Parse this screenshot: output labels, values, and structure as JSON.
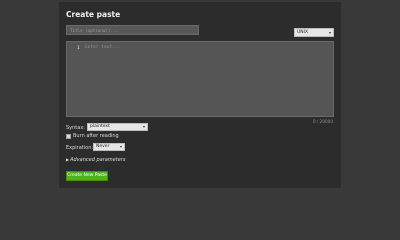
{
  "form": {
    "title": "Create paste",
    "title_placeholder": "Title (optional)...",
    "format_value": "UNIX",
    "editor": {
      "line_number": "1",
      "placeholder": "Enter text...",
      "value": ""
    },
    "char_count": "0 / 20000",
    "syntax": {
      "label": "Syntax:",
      "value": "plaintext"
    },
    "burn_after_reading": {
      "label": "Burn after reading",
      "checked": false
    },
    "expiration": {
      "label": "Expiration:",
      "value": "Never"
    },
    "advanced_label": "Advanced parameters",
    "advanced_icon": "triangle-right-icon",
    "submit_label": "Create New Paste"
  },
  "colors": {
    "page_bg": "#393939",
    "panel_bg": "#2c2c2c",
    "editor_bg": "#555555",
    "submit_green": "#52b219"
  }
}
